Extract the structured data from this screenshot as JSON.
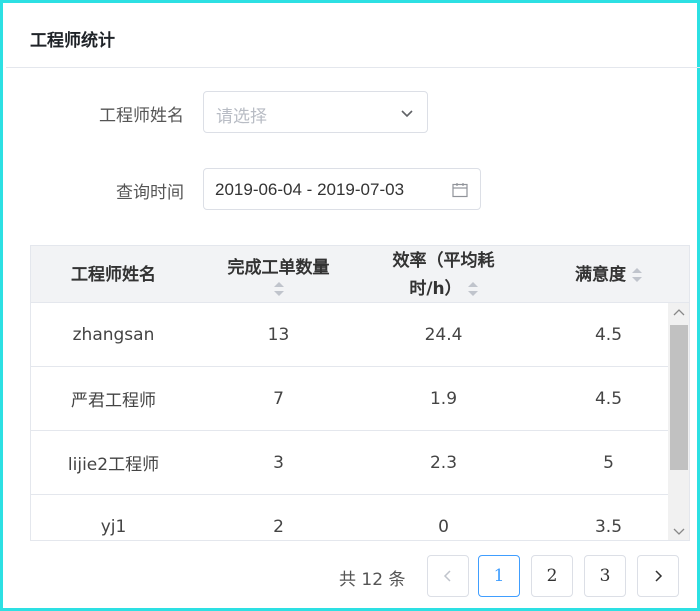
{
  "header": {
    "title": "工程师统计"
  },
  "form": {
    "engineer_label": "工程师姓名",
    "engineer_placeholder": "请选择",
    "time_label": "查询时间",
    "date_range": "2019-06-04 - 2019-07-03"
  },
  "table": {
    "columns": [
      {
        "label": "工程师姓名",
        "sortable": false
      },
      {
        "label": "完成工单数量",
        "sortable": true
      },
      {
        "label_line1": "效率（平均耗",
        "label_line2": "时/h）",
        "sortable": true
      },
      {
        "label": "满意度",
        "sortable": true
      }
    ],
    "rows": [
      {
        "name": "zhangsan",
        "count": "13",
        "efficiency": "24.4",
        "satisfaction": "4.5"
      },
      {
        "name": "严君工程师",
        "count": "7",
        "efficiency": "1.9",
        "satisfaction": "4.5"
      },
      {
        "name": "lijie2工程师",
        "count": "3",
        "efficiency": "2.3",
        "satisfaction": "5"
      },
      {
        "name": "yj1",
        "count": "2",
        "efficiency": "0",
        "satisfaction": "3.5"
      }
    ]
  },
  "pagination": {
    "total_text": "共 12 条",
    "pages": [
      "1",
      "2",
      "3"
    ],
    "current_page": "1"
  },
  "icons": {
    "select": "chevron-down-icon",
    "date": "calendar-icon",
    "prev": "chevron-left-icon",
    "next": "chevron-right-icon"
  },
  "colors": {
    "accent": "#409eff",
    "frame": "#2de0e3",
    "header_bg": "#f2f3f5"
  }
}
